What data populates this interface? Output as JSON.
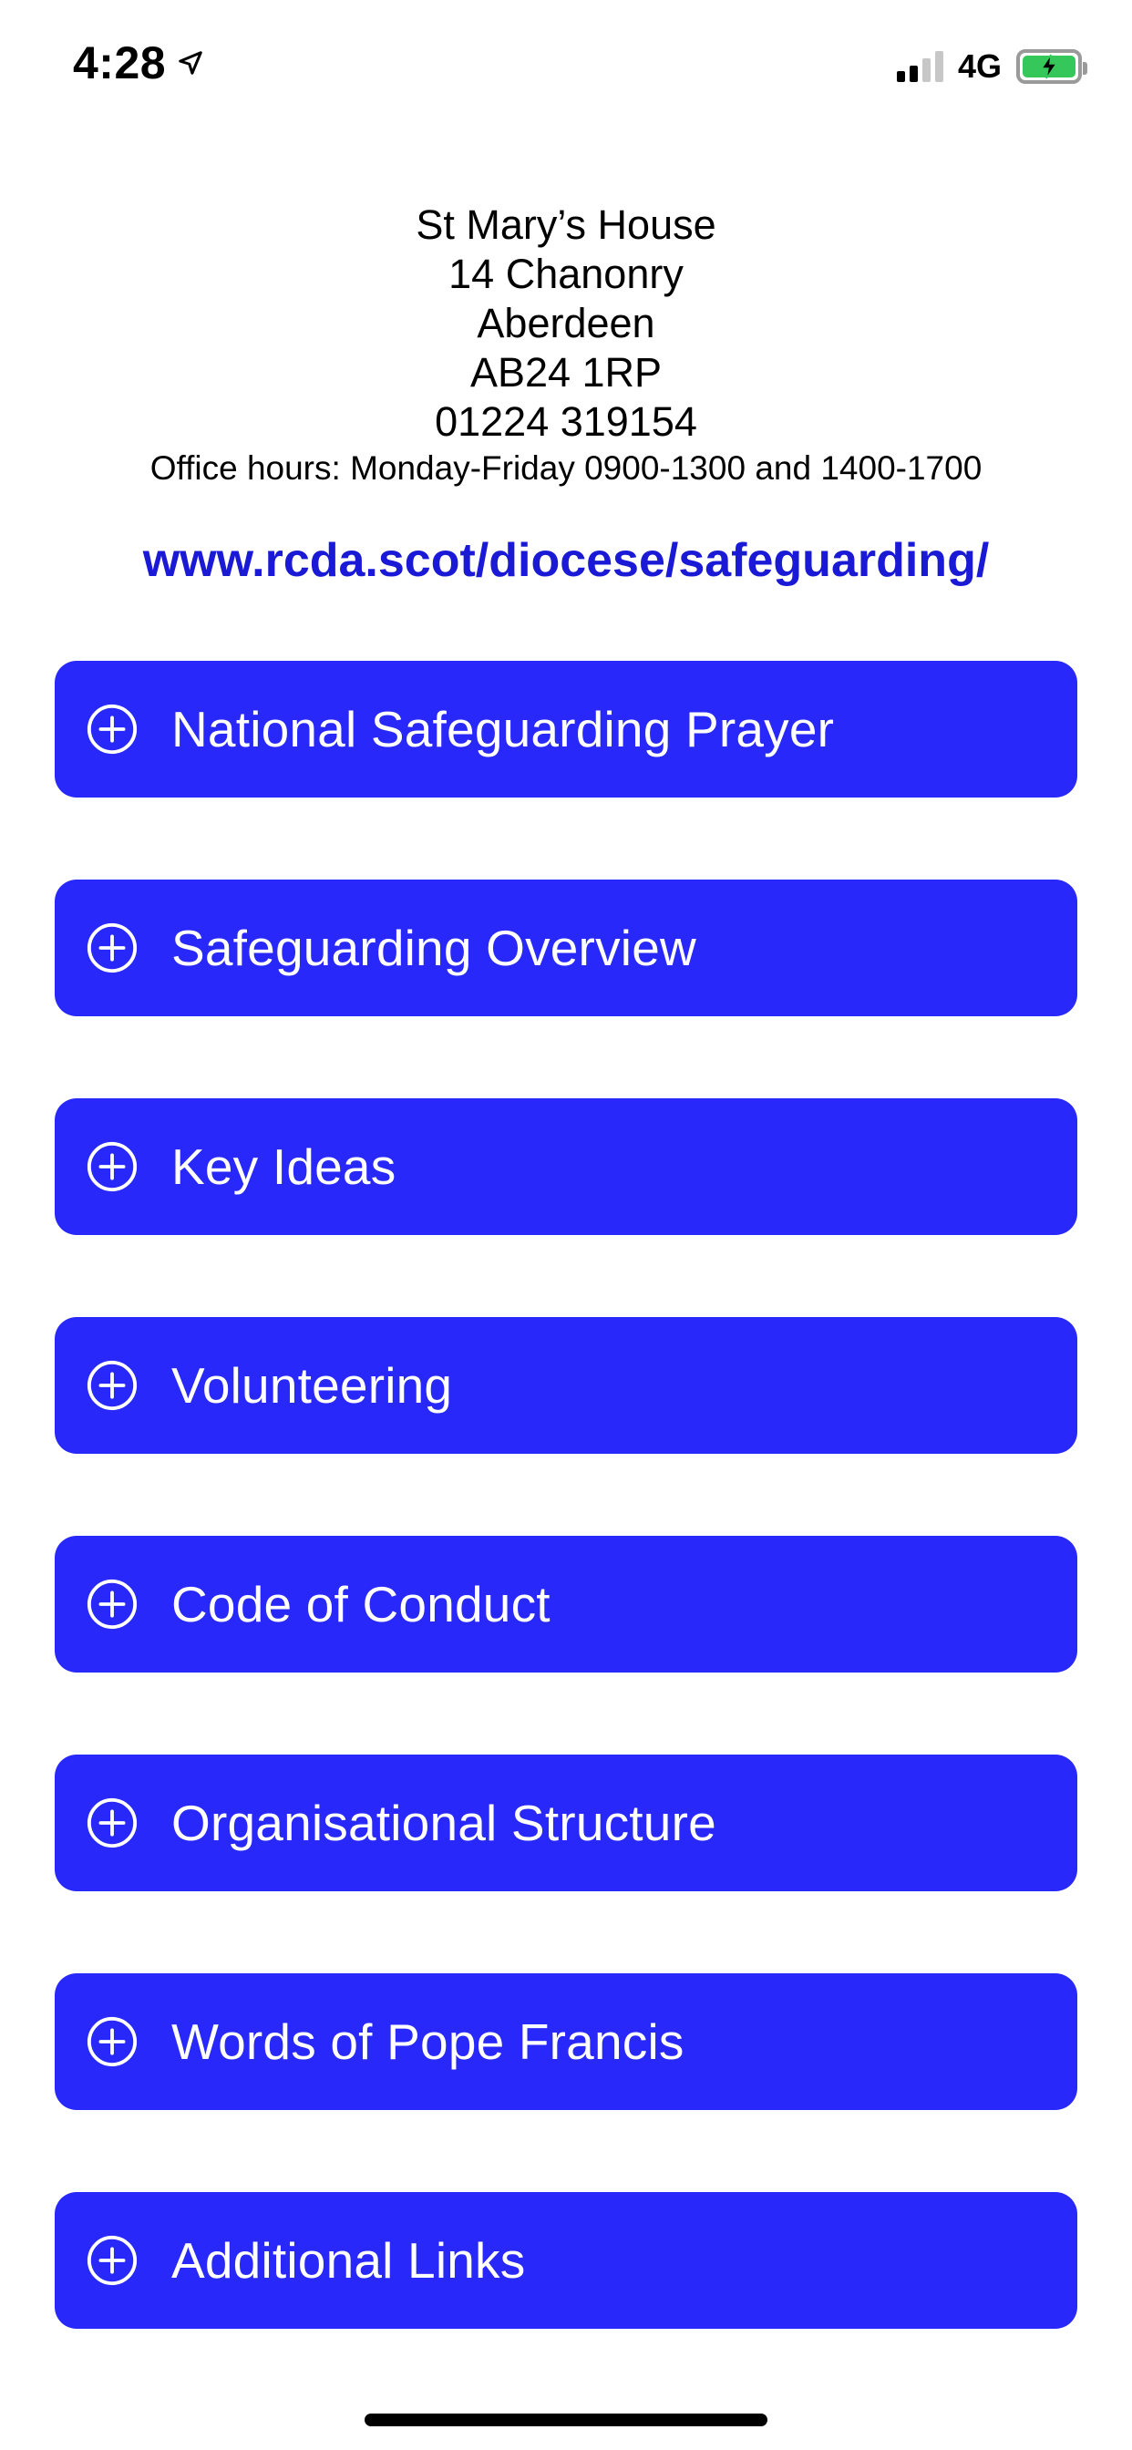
{
  "status_bar": {
    "time": "4:28",
    "network": "4G",
    "location_icon": "location-arrow-icon",
    "battery_icon": "battery-charging-icon",
    "signal_icon": "cellular-signal-icon"
  },
  "address": {
    "lines": [
      "St Mary’s House",
      "14 Chanonry",
      "Aberdeen",
      "AB24 1RP",
      "01224 319154"
    ],
    "office_hours": "Office hours: Monday-Friday 0900-1300 and 1400-1700"
  },
  "website": "www.rcda.scot/diocese/safeguarding/",
  "menu": {
    "items": [
      {
        "label": "National Safeguarding Prayer"
      },
      {
        "label": "Safeguarding Overview"
      },
      {
        "label": "Key Ideas"
      },
      {
        "label": "Volunteering"
      },
      {
        "label": "Code of Conduct"
      },
      {
        "label": "Organisational Structure"
      },
      {
        "label": "Words of Pope Francis"
      },
      {
        "label": "Additional Links"
      }
    ]
  },
  "colors": {
    "button_bg": "#2828fb",
    "link": "#1a1ad6",
    "battery_fill": "#35c759"
  }
}
